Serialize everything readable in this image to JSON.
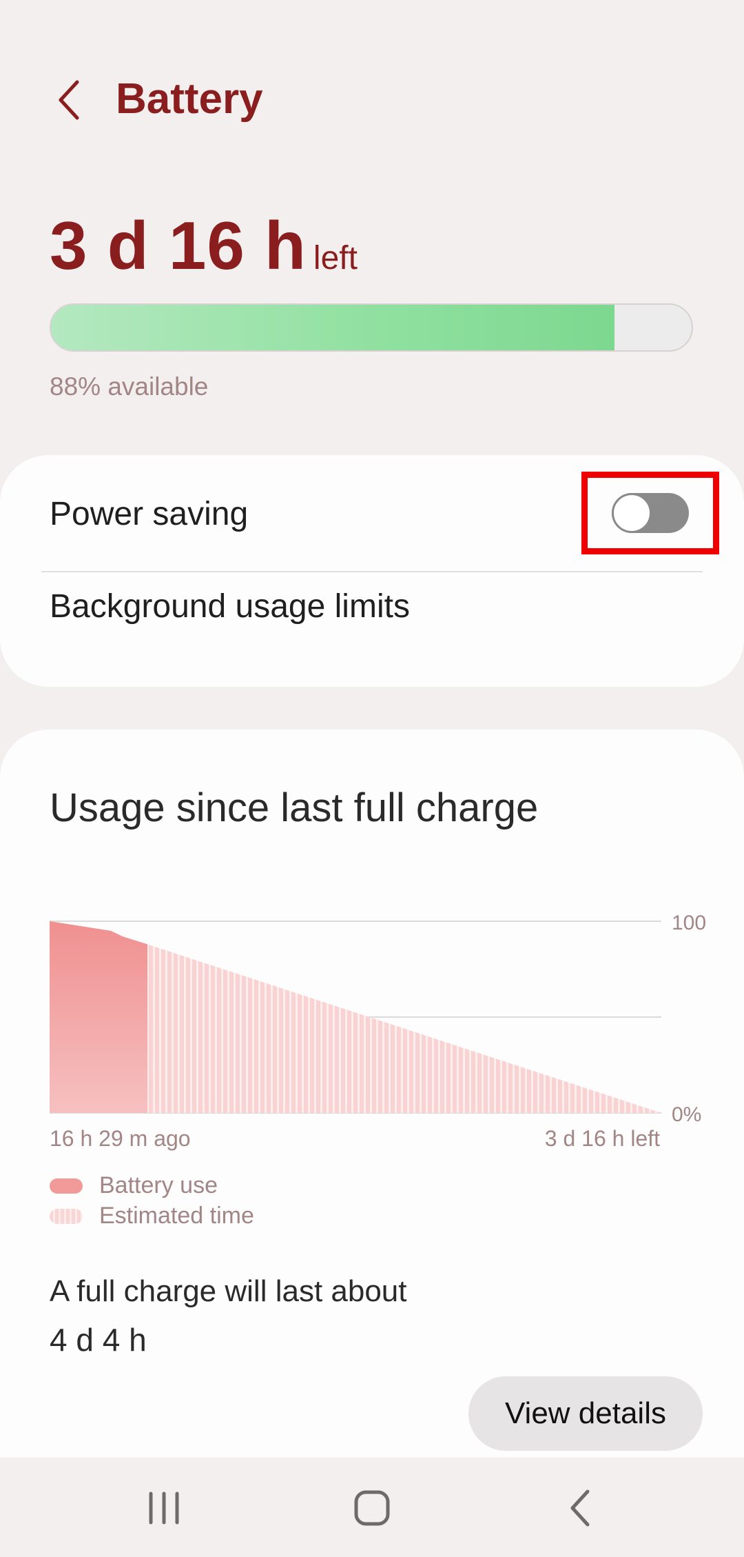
{
  "header": {
    "title": "Battery",
    "back_icon": "chevron-left-icon"
  },
  "battery": {
    "time_left_value": "3 d 16 h",
    "time_left_suffix": "left",
    "level_percent": 88,
    "available_text": "88% available"
  },
  "settings": {
    "power_saving_label": "Power saving",
    "power_saving_on": false,
    "background_limits_label": "Background usage limits"
  },
  "usage": {
    "title": "Usage since last full charge",
    "legend_use": "Battery use",
    "legend_estimated": "Estimated time",
    "full_charge_label": "A full charge will last about",
    "full_charge_value": "4 d 4 h",
    "view_details_label": "View details"
  },
  "chart_data": {
    "type": "area",
    "series": [
      {
        "name": "Battery use",
        "x": [
          0,
          0.06,
          0.1,
          0.12,
          0.16
        ],
        "values": [
          100,
          97,
          95,
          92,
          88
        ]
      },
      {
        "name": "Estimated time",
        "x": [
          0.16,
          1.0
        ],
        "values": [
          88,
          0
        ]
      }
    ],
    "ylim": [
      0,
      100
    ],
    "y_tick_labels": [
      "100",
      "0%"
    ],
    "x_tick_labels": [
      "16 h 29 m ago",
      "3 d 16 h left"
    ],
    "grid": true
  },
  "colors": {
    "accent": "#8a1d1d",
    "battery_fill": "#8fe09f",
    "use_color": "#f09a9a",
    "estimate_color": "#f9d6d6",
    "highlight_box": "#ee0000"
  },
  "navbar": {
    "recents_icon": "recent-apps-icon",
    "home_icon": "home-icon",
    "back_icon": "back-icon"
  }
}
